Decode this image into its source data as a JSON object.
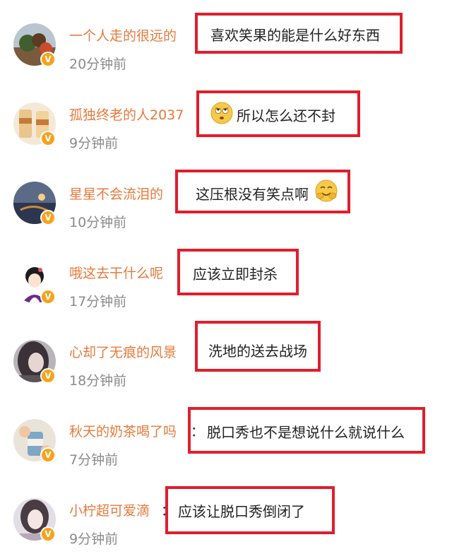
{
  "accent_colors": {
    "username": "#e7793b",
    "highlight_border": "#e01e2c",
    "verified_badge": "#f7a21b",
    "timestamp": "#8a8a8a"
  },
  "comments": [
    {
      "username": "一个人走的很远的",
      "text": "喜欢笑果的能是什么好东西",
      "time": "20分钟前",
      "badge": "V",
      "emoji": null
    },
    {
      "username": "孤独终老的人2037",
      "text": "所以怎么还不封",
      "time": "9分钟前",
      "badge": "V",
      "emoji": "eye-roll-emoji"
    },
    {
      "username": "星星不会流泪的",
      "text": "这压根没有笑点啊",
      "time": "10分钟前",
      "badge": "V",
      "emoji": "hug-emoji"
    },
    {
      "username": "哦这去干什么呢",
      "text": "应该立即封杀",
      "time": "17分钟前",
      "badge": "V",
      "emoji": null
    },
    {
      "username": "心却了无痕的风景",
      "text": "洗地的送去战场",
      "time": "18分钟前",
      "badge": "V",
      "emoji": null
    },
    {
      "username": "秋天的奶茶喝了吗",
      "colon": "：",
      "text": "脱口秀也不是想说什么就说什么",
      "time": "7分钟前",
      "badge": "V",
      "emoji": null
    },
    {
      "username": "小柠超可爱滴",
      "colon": "：",
      "text": "应该让脱口秀倒闭了",
      "time": "9分钟前",
      "badge": "V",
      "emoji": null
    }
  ]
}
